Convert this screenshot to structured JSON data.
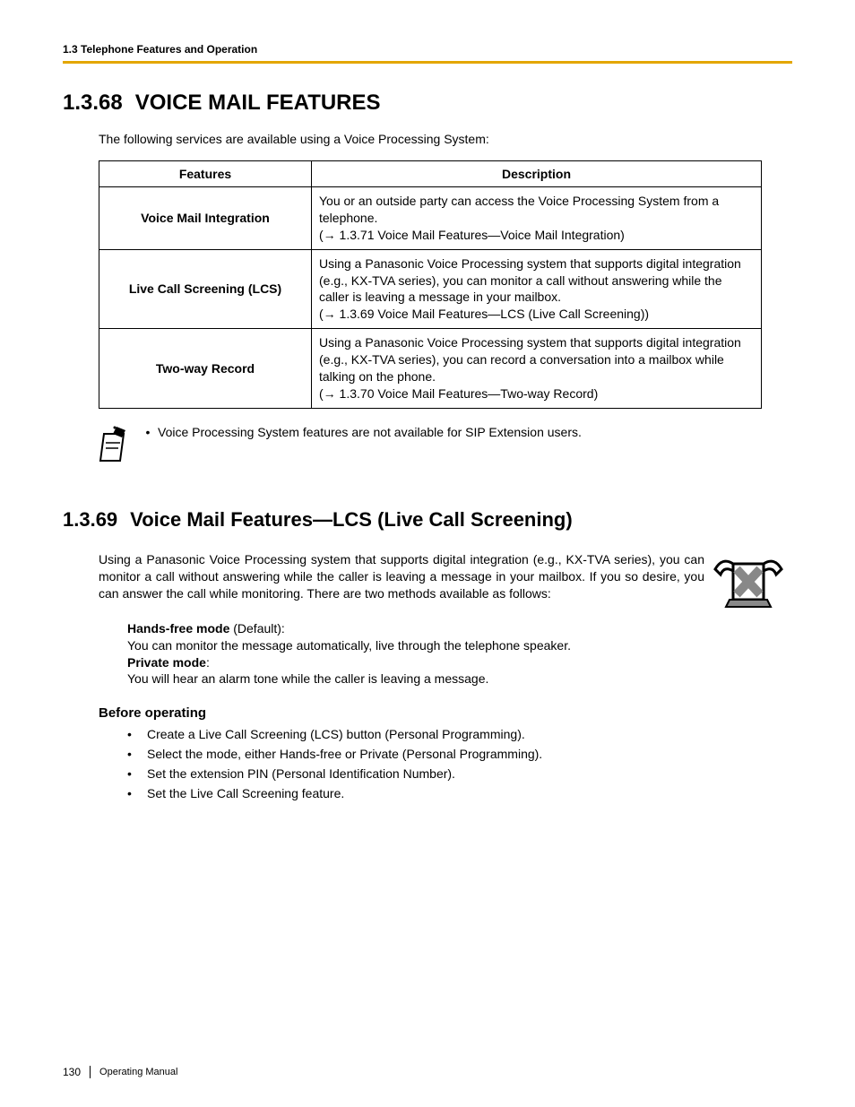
{
  "header": {
    "running": "1.3 Telephone Features and Operation"
  },
  "s68": {
    "num": "1.3.68",
    "title": "VOICE MAIL FEATURES",
    "intro": "The following services are available using a Voice Processing System:",
    "th_feat": "Features",
    "th_desc": "Description",
    "rows": [
      {
        "name": "Voice Mail Integration",
        "desc": "You or an outside party can access the Voice Processing System from a telephone.",
        "ref": "(→ 1.3.71 Voice Mail Features—Voice Mail Integration)"
      },
      {
        "name": "Live Call Screening (LCS)",
        "desc": "Using a Panasonic Voice Processing system that supports digital integration (e.g., KX-TVA series), you can monitor a call without answering while the caller is leaving a message in your mailbox.",
        "ref": "(→ 1.3.69 Voice Mail Features—LCS (Live Call Screening))"
      },
      {
        "name": "Two-way Record",
        "desc": "Using a Panasonic Voice Processing system that supports digital integration (e.g., KX-TVA series), you can record a conversation into a mailbox while talking on the phone.",
        "ref": "(→ 1.3.70 Voice Mail Features—Two-way Record)"
      }
    ],
    "note": "Voice Processing System features are not available for SIP Extension users."
  },
  "s69": {
    "num": "1.3.69",
    "title": "Voice Mail Features—LCS (Live Call Screening)",
    "para": "Using a Panasonic Voice Processing system that supports digital integration (e.g., KX-TVA series), you can monitor a call without answering while the caller is leaving a message in your mailbox. If you so desire, you can answer the call while monitoring. There are two methods available as follows:",
    "mode1_label": "Hands-free mode",
    "mode1_default": " (Default):",
    "mode1_text": "You can monitor the message automatically, live through the telephone speaker.",
    "mode2_label": "Private mode",
    "mode2_colon": ":",
    "mode2_text": "You will hear an alarm tone while the caller is leaving a message.",
    "before_head": "Before operating",
    "bullets": [
      "Create a Live Call Screening (LCS) button (Personal Programming).",
      "Select the mode, either Hands-free or Private (Personal Programming).",
      "Set the extension PIN (Personal Identification Number).",
      "Set the Live Call Screening feature."
    ]
  },
  "footer": {
    "page": "130",
    "doc": "Operating Manual"
  }
}
